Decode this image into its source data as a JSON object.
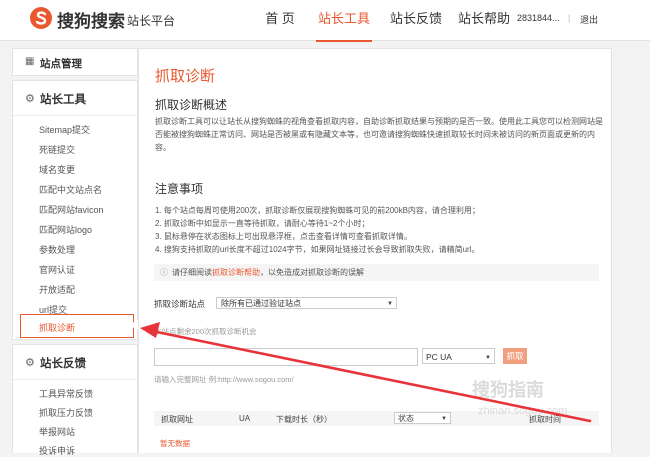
{
  "header": {
    "logo_text": "搜狗搜索",
    "logo_sub": "站长平台",
    "nav": [
      "首 页",
      "站长工具",
      "站长反馈",
      "站长帮助"
    ],
    "active_nav": 1,
    "user": "2831844...",
    "divider": "|",
    "logout": "退出"
  },
  "sidebar": {
    "site_manage": "站点管理",
    "tools_title": "站长工具",
    "tools_items": [
      "Sitemap提交",
      "死链提交",
      "域名变更",
      "匹配中文站点名",
      "匹配网站favicon",
      "匹配网站logo",
      "参数处理",
      "官网认证",
      "开放适配",
      "url提交",
      "抓取诊断"
    ],
    "active_item": 10,
    "feedback_title": "站长反馈",
    "feedback_items": [
      "工具异常反馈",
      "抓取压力反馈",
      "举报网站",
      "投诉申诉"
    ]
  },
  "main": {
    "title": "抓取诊断",
    "overview_title": "抓取诊断概述",
    "overview_text": "抓取诊断工具可以让站长从搜狗蜘蛛的视角查看抓取内容，自助诊断抓取结果与预期的是否一致。使用此工具您可以检测网站是否能被搜狗蜘蛛正常访问、网站是否被黑或有隐藏文本等，也可邀请搜狗蜘蛛快速抓取较长时间未被访问的新页面或更新的内容。",
    "notice_title": "注意事项",
    "notices": [
      "1. 每个站点每周可使用200次，抓取诊断仅展现搜狗蜘蛛可见的前200kB内容，请合理利用；",
      "2. 抓取诊断中如显示一直等待抓取，请耐心等待1~2个小时；",
      "3. 鼠标悬停在状态图标上可出现悬浮框，点击查看详情可查看抓取详情。",
      "4. 搜狗支持抓取的url长度不超过1024字节，如果网址链接过长会导致抓取失败，请精简url。"
    ],
    "tip_prefix": "请仔细阅读",
    "tip_link": "抓取诊断帮助",
    "tip_suffix": "，以免造成对抓取诊断的误解",
    "site_label": "抓取诊断站点",
    "site_select": "除所有已通过验证站点",
    "remaining": "本站点剩余200次抓取诊断机会",
    "ua_value": "PC UA",
    "grab_button": "抓取",
    "example": "请输入完整网址 例:http://www.sogou.com/",
    "table_headers": [
      "抓取网址",
      "UA",
      "下载时长（秒）",
      "状态",
      "抓取时间"
    ],
    "empty_text": "暂无数据"
  },
  "watermark": {
    "text": "搜狗指南",
    "url": "zhinan.sogou.com"
  }
}
